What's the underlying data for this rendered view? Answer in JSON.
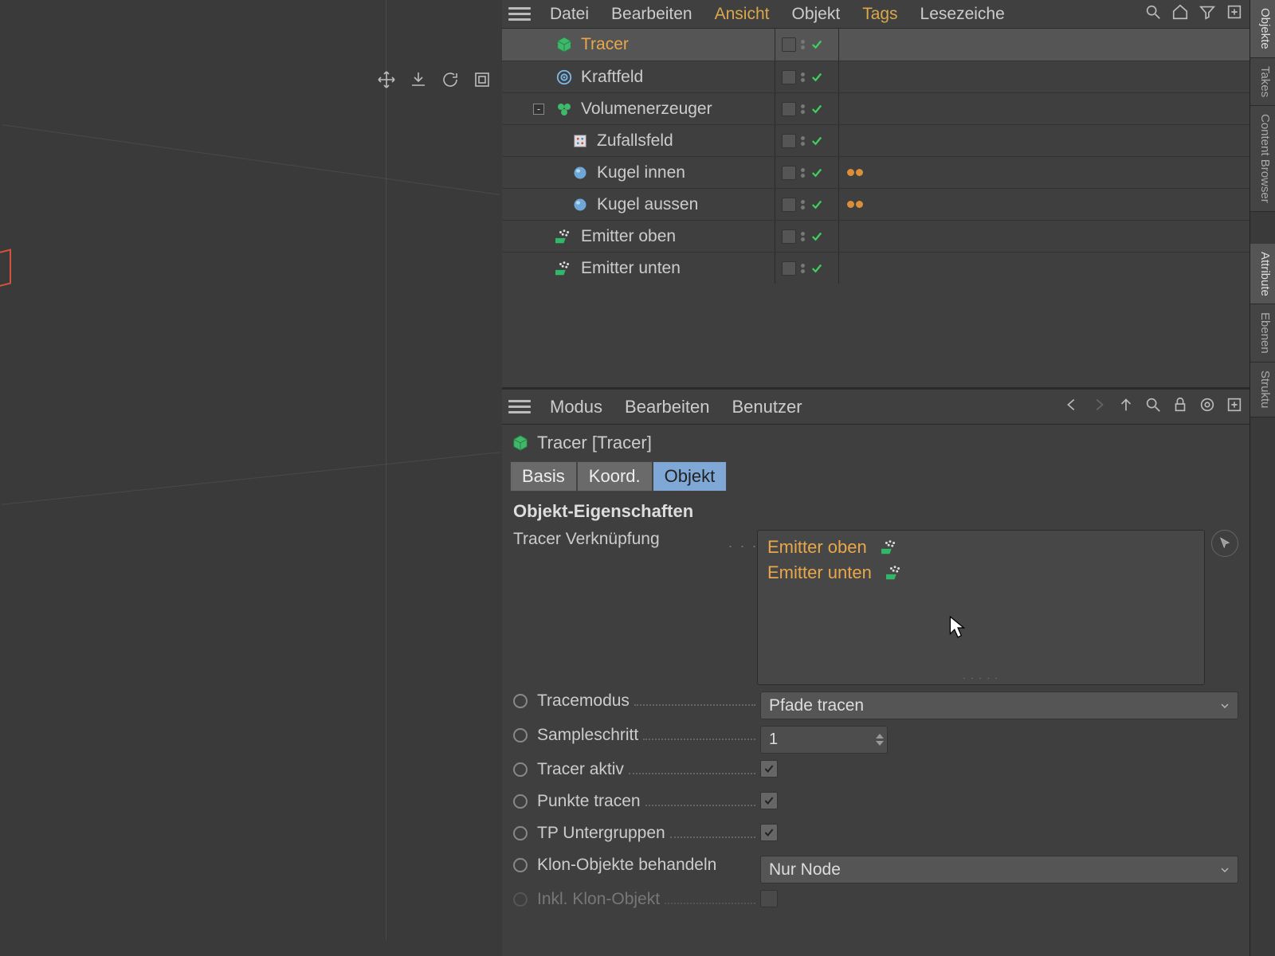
{
  "menubar": {
    "datei": "Datei",
    "bearbeiten": "Bearbeiten",
    "ansicht": "Ansicht",
    "objekt": "Objekt",
    "tags": "Tags",
    "lesezeiche": "Lesezeiche"
  },
  "side_tabs": {
    "objekte": "Objekte",
    "takes": "Takes",
    "content": "Content Browser",
    "attribute": "Attribute",
    "ebenen": "Ebenen",
    "struktu": "Struktu"
  },
  "tree": [
    {
      "name": "Tracer",
      "selected": true,
      "icon": "cube"
    },
    {
      "name": "Kraftfeld",
      "icon": "field"
    },
    {
      "name": "Volumenerzeuger",
      "icon": "vol",
      "expander": "-"
    },
    {
      "name": "Zufallsfeld",
      "icon": "rand",
      "child": true
    },
    {
      "name": "Kugel innen",
      "icon": "sphere",
      "child": true,
      "tags": true
    },
    {
      "name": "Kugel aussen",
      "icon": "sphere",
      "child": true,
      "tags": true
    },
    {
      "name": "Emitter oben",
      "icon": "emit"
    },
    {
      "name": "Emitter unten",
      "icon": "emit"
    }
  ],
  "attr_menu": {
    "modus": "Modus",
    "bearbeiten": "Bearbeiten",
    "benutzer": "Benutzer"
  },
  "obj_header": "Tracer [Tracer]",
  "tabs": {
    "basis": "Basis",
    "koord": "Koord.",
    "objekt": "Objekt"
  },
  "section": "Objekt-Eigenschaften",
  "props": {
    "verknupfung": "Tracer Verknüpfung",
    "tracemodus": "Tracemodus",
    "sampleschritt": "Sampleschritt",
    "tracer_aktiv": "Tracer aktiv",
    "punkte_tracen": "Punkte tracen",
    "tp_unter": "TP Untergruppen",
    "klon": "Klon-Objekte behandeln",
    "inkl": "Inkl. Klon-Objekt"
  },
  "well": [
    "Emitter oben",
    "Emitter unten"
  ],
  "tracemodus_val": "Pfade tracen",
  "sampleschritt_val": "1",
  "klon_val": "Nur Node"
}
